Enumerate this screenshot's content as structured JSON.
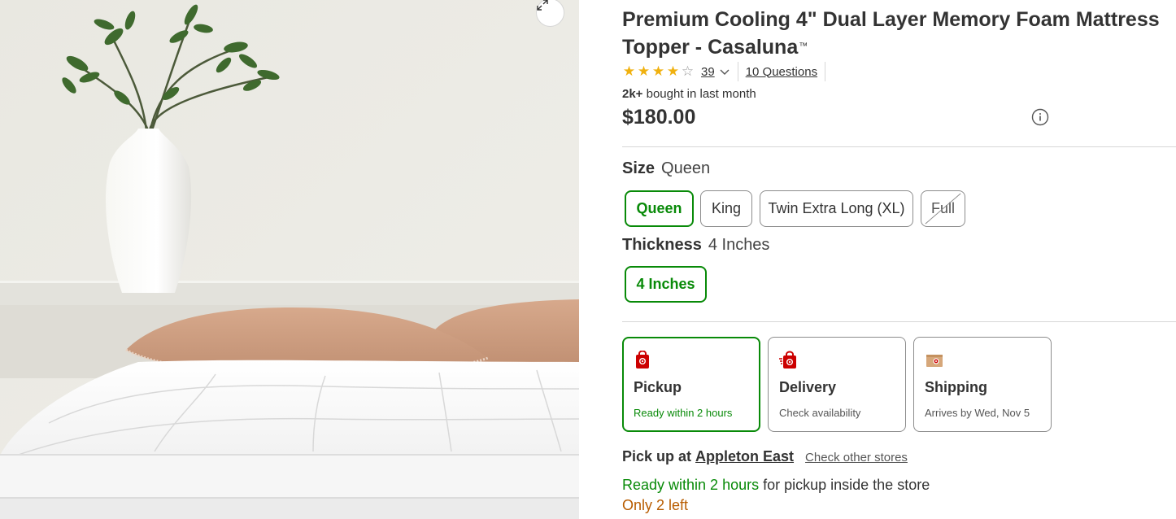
{
  "product": {
    "title": "Premium Cooling 4\" Dual Layer Memory Foam Mattress Topper - Casaluna",
    "trademark": "™",
    "rating": 3.5,
    "rating_count": "39",
    "questions_link": "10 Questions",
    "bought_bold": "2k+",
    "bought_rest": " bought in last month",
    "price": "$180.00"
  },
  "size": {
    "label": "Size",
    "selected": "Queen",
    "options": [
      {
        "label": "Queen",
        "state": "selected"
      },
      {
        "label": "King",
        "state": "available"
      },
      {
        "label": "Twin Extra Long (XL)",
        "state": "available"
      },
      {
        "label": "Full",
        "state": "unavailable"
      }
    ]
  },
  "thickness": {
    "label": "Thickness",
    "selected": "4 Inches",
    "options": [
      {
        "label": "4 Inches",
        "state": "selected"
      }
    ]
  },
  "fulfillment": {
    "options": [
      {
        "name": "Pickup",
        "detail": "Ready within 2 hours",
        "icon": "pickup-store-icon",
        "selected": true
      },
      {
        "name": "Delivery",
        "detail": "Check availability",
        "icon": "delivery-bag-icon",
        "selected": false
      },
      {
        "name": "Shipping",
        "detail": "Arrives by Wed, Nov 5",
        "icon": "shipping-box-icon",
        "selected": false
      }
    ]
  },
  "pickup": {
    "label": "Pick up at",
    "store": "Appleton East",
    "other_stores": "Check other stores",
    "ready_green": "Ready within 2 hours",
    "ready_rest": " for pickup inside the store",
    "stock": "Only 2 left"
  },
  "colors": {
    "accent_green": "#088a08",
    "target_red": "#cc0000",
    "star_gold": "#f0b10f",
    "stock_orange": "#b85c00"
  }
}
